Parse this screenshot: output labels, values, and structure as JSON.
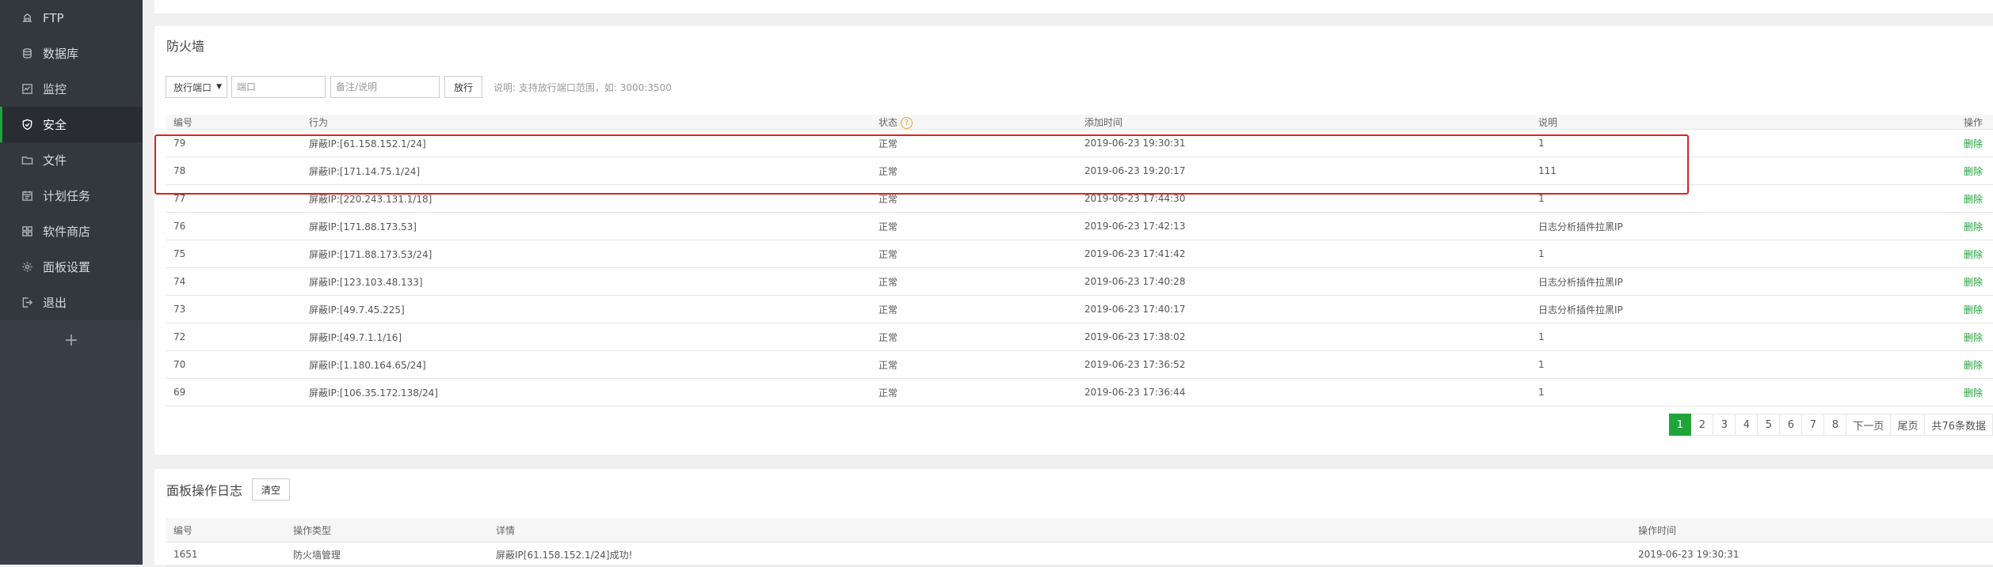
{
  "sidebar": {
    "items": [
      {
        "label": "FTP",
        "icon": "ftp-icon"
      },
      {
        "label": "数据库",
        "icon": "database-icon"
      },
      {
        "label": "监控",
        "icon": "monitor-icon"
      },
      {
        "label": "安全",
        "icon": "shield-icon",
        "active": true
      },
      {
        "label": "文件",
        "icon": "folder-icon"
      },
      {
        "label": "计划任务",
        "icon": "calendar-icon"
      },
      {
        "label": "软件商店",
        "icon": "grid-icon"
      },
      {
        "label": "面板设置",
        "icon": "gear-icon"
      },
      {
        "label": "退出",
        "icon": "logout-icon"
      }
    ],
    "add_label": "+"
  },
  "firewall": {
    "title": "防火墙",
    "port_select": "放行端口",
    "port_placeholder": "端口",
    "remark_placeholder": "备注/说明",
    "allow_button": "放行",
    "hint": "说明: 支持放行端口范围，如: 3000:3500",
    "headers": {
      "id": "编号",
      "action": "行为",
      "status": "状态",
      "added": "添加时间",
      "note": "说明",
      "op": "操作"
    },
    "rows": [
      {
        "id": "79",
        "action": "屏蔽IP:[61.158.152.1/24]",
        "status": "正常",
        "time": "2019-06-23 19:30:31",
        "note": "1",
        "op": "删除"
      },
      {
        "id": "78",
        "action": "屏蔽IP:[171.14.75.1/24]",
        "status": "正常",
        "time": "2019-06-23 19:20:17",
        "note": "111",
        "op": "删除"
      },
      {
        "id": "77",
        "action": "屏蔽IP:[220.243.131.1/18]",
        "status": "正常",
        "time": "2019-06-23 17:44:30",
        "note": "1",
        "op": "删除"
      },
      {
        "id": "76",
        "action": "屏蔽IP:[171.88.173.53]",
        "status": "正常",
        "time": "2019-06-23 17:42:13",
        "note": "日志分析插件拉黑IP",
        "op": "删除"
      },
      {
        "id": "75",
        "action": "屏蔽IP:[171.88.173.53/24]",
        "status": "正常",
        "time": "2019-06-23 17:41:42",
        "note": "1",
        "op": "删除"
      },
      {
        "id": "74",
        "action": "屏蔽IP:[123.103.48.133]",
        "status": "正常",
        "time": "2019-06-23 17:40:28",
        "note": "日志分析插件拉黑IP",
        "op": "删除"
      },
      {
        "id": "73",
        "action": "屏蔽IP:[49.7.45.225]",
        "status": "正常",
        "time": "2019-06-23 17:40:17",
        "note": "日志分析插件拉黑IP",
        "op": "删除"
      },
      {
        "id": "72",
        "action": "屏蔽IP:[49.7.1.1/16]",
        "status": "正常",
        "time": "2019-06-23 17:38:02",
        "note": "1",
        "op": "删除"
      },
      {
        "id": "70",
        "action": "屏蔽IP:[1.180.164.65/24]",
        "status": "正常",
        "time": "2019-06-23 17:36:52",
        "note": "1",
        "op": "删除"
      },
      {
        "id": "69",
        "action": "屏蔽IP:[106.35.172.138/24]",
        "status": "正常",
        "time": "2019-06-23 17:36:44",
        "note": "1",
        "op": "删除"
      }
    ],
    "pager": {
      "pages": [
        "1",
        "2",
        "3",
        "4",
        "5",
        "6",
        "7",
        "8"
      ],
      "current": "1",
      "next": "下一页",
      "last": "尾页",
      "total": "共76条数据"
    }
  },
  "log": {
    "title": "面板操作日志",
    "clear_button": "清空",
    "headers": {
      "id": "编号",
      "type": "操作类型",
      "detail": "详情",
      "time": "操作时间"
    },
    "rows": [
      {
        "id": "1651",
        "type": "防火墙管理",
        "detail": "屏蔽IP[61.158.152.1/24]成功!",
        "time": "2019-06-23 19:30:31"
      }
    ]
  },
  "colors": {
    "accent": "#20a53a",
    "highlight": "#e02020",
    "sidebar": "#3a3f47"
  }
}
